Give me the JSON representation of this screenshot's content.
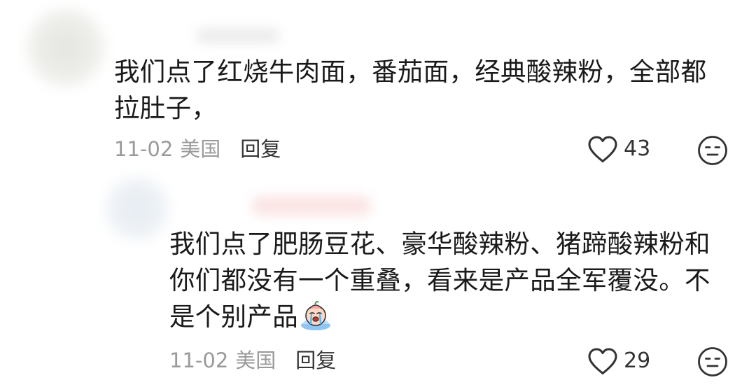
{
  "comments": [
    {
      "text": "我们点了红烧牛肉面，番茄面，经典酸辣粉，全部都拉肚子，",
      "date": "11-02",
      "location": "美国",
      "reply_label": "回复",
      "likes": "43",
      "like_icon": "heart-outline-icon",
      "dislike_icon": "meh-face-icon"
    },
    {
      "text": "我们点了肥肠豆花、豪华酸辣粉、猪蹄酸辣粉和你们都没有一个重叠，看来是产品全军覆没。不是个别产品",
      "emoji": "crying-emoji",
      "date": "11-02",
      "location": "美国",
      "reply_label": "回复",
      "likes": "29",
      "like_icon": "heart-outline-icon",
      "dislike_icon": "meh-face-icon"
    }
  ],
  "colors": {
    "text": "#1a1a1a",
    "meta": "#9a9a9a",
    "reply": "#333333",
    "icon": "#333333"
  }
}
